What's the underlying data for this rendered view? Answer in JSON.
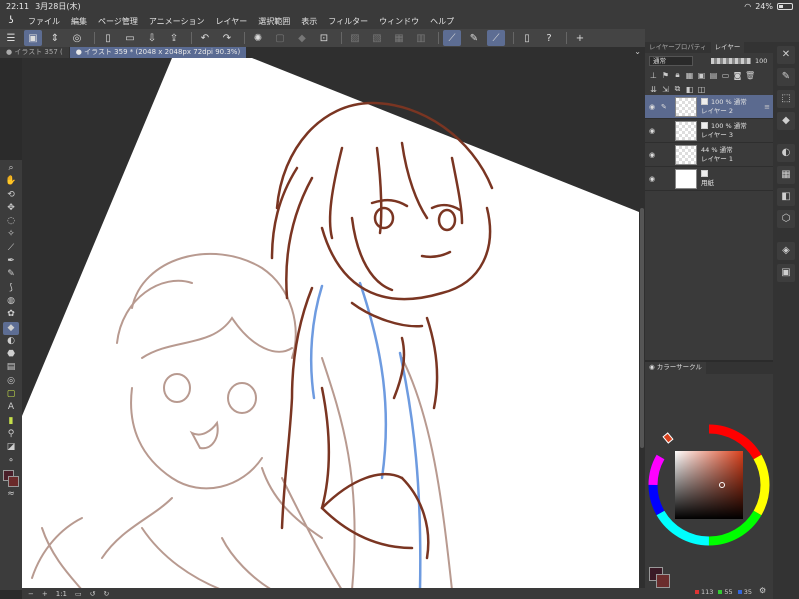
{
  "status": {
    "time": "22:11",
    "date": "3月28日(木)",
    "battery": "24%"
  },
  "menu": [
    "ファイル",
    "編集",
    "ページ管理",
    "アニメーション",
    "レイヤー",
    "選択範囲",
    "表示",
    "フィルター",
    "ウィンドウ",
    "ヘルプ"
  ],
  "tabs": [
    {
      "label": "● イラスト 357 ("
    },
    {
      "label": "● イラスト 359 * (2048 x 2048px 72dpi 90.3%)"
    }
  ],
  "layers_panel": {
    "tabs": [
      "レイヤープロパティ",
      "レイヤー"
    ],
    "blend": "通常",
    "opacity": "100",
    "layers": [
      {
        "opacity_blend": "100 % 通常",
        "name": "レイヤー 2"
      },
      {
        "opacity_blend": "100 % 通常",
        "name": "レイヤー 3"
      },
      {
        "opacity_blend": "44 % 通常",
        "name": "レイヤー 1"
      },
      {
        "opacity_blend": "",
        "name": "用紙"
      }
    ]
  },
  "color_panel": {
    "tab": "カラーサークル",
    "r": "113",
    "g": "55",
    "b": "35"
  },
  "navigator": {
    "zoom": "1:1"
  },
  "colors": {
    "line_dark": "#7a3522",
    "line_light": "#b89a90",
    "line_blue": "#6e9be0",
    "selection": "#5b6a8f"
  }
}
